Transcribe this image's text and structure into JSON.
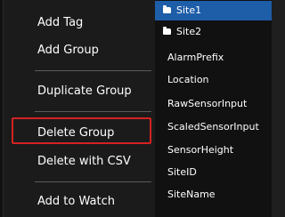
{
  "tree": {
    "sites": [
      {
        "label": "Site1",
        "icon": "folder-icon",
        "selected": true
      },
      {
        "label": "Site2",
        "icon": "folder-icon",
        "selected": false
      }
    ],
    "properties": [
      "AlarmPrefix",
      "Location",
      "RawSensorInput",
      "ScaledSensorInput",
      "SensorHeight",
      "SiteID",
      "SiteName"
    ],
    "selected_color": "#1e5da8"
  },
  "menu": {
    "add_tag": "Add Tag",
    "add_group": "Add Group",
    "duplicate_group": "Duplicate Group",
    "delete_group": "Delete Group",
    "delete_with_csv": "Delete with CSV",
    "add_to_watch": "Add to Watch",
    "highlight_color": "#d32222"
  }
}
